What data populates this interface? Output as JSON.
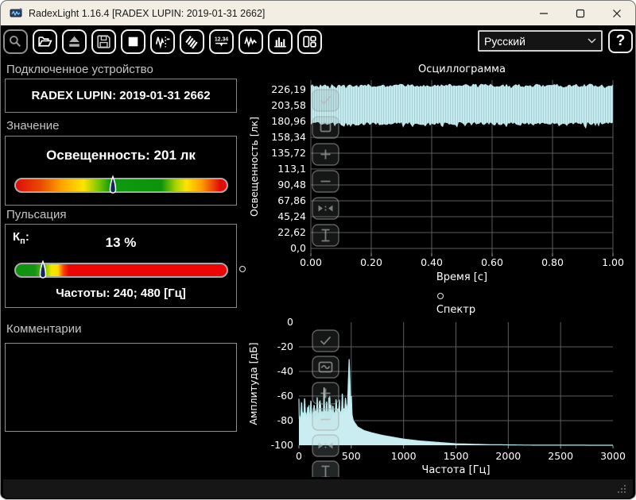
{
  "window": {
    "title": "RadexLight 1.16.4 [RADEX LUPIN: 2019-01-31 2662]"
  },
  "toolbar": {
    "buttons": [
      {
        "name": "search-device",
        "icon": "magnifier-icon",
        "enabled": false
      },
      {
        "name": "open-file",
        "icon": "open-folder-icon",
        "enabled": true
      },
      {
        "name": "eject-device",
        "icon": "eject-icon",
        "enabled": false
      },
      {
        "name": "save-file",
        "icon": "floppy-disk-icon",
        "enabled": false
      },
      {
        "name": "stop-measurement",
        "icon": "stop-square-icon",
        "enabled": true
      },
      {
        "name": "measurement-mode",
        "icon": "waveform-marker-icon",
        "enabled": true
      },
      {
        "name": "pulsation-mode",
        "icon": "hatch-lines-icon",
        "enabled": true
      },
      {
        "name": "value-display-view",
        "icon": "digital-readout-icon",
        "label_in_icon": "12.34",
        "enabled": true
      },
      {
        "name": "oscillogram-view",
        "icon": "oscillogram-icon",
        "enabled": true
      },
      {
        "name": "spectrum-view",
        "icon": "bar-chart-icon",
        "enabled": true
      },
      {
        "name": "layout-view",
        "icon": "layout-panels-icon",
        "enabled": true
      }
    ],
    "language_select": {
      "value": "Русский"
    },
    "help_label": "?"
  },
  "left_panel": {
    "device": {
      "header": "Подключенное устройство",
      "name": "RADEX LUPIN: 2019-01-31 2662"
    },
    "value": {
      "header": "Значение",
      "reading": "Освещенность: 201 лк",
      "marker_fraction": 0.46
    },
    "pulsation": {
      "header": "Пульсация",
      "coef_main": "К",
      "coef_sub": "п",
      "coef_colon": ":",
      "value": "13 %",
      "marker_fraction": 0.13,
      "frequencies": "Частоты: 240; 480 [Гц]"
    },
    "comments": {
      "header": "Комментарии",
      "text": ""
    }
  },
  "colors": {
    "accent_cyan": "#c9edf1",
    "cyan_edge": "#b9ecf0",
    "grid": "#5d5d5d",
    "titlebar_bg": "#f2eee3",
    "good_green": "#0c940c",
    "warn_yellow": "#ffe400",
    "bad_red": "#e00b0b"
  },
  "chart_data": [
    {
      "type": "area",
      "title": "Осциллограмма",
      "xlabel": "Время [с]",
      "ylabel": "Освещенность [лк]",
      "xlim": [
        0,
        1
      ],
      "xticks": [
        "0.00",
        "0.20",
        "0.40",
        "0.60",
        "0.80",
        "1.00"
      ],
      "ylim": [
        0,
        239.8
      ],
      "yticks": [
        226.19,
        203.58,
        180.96,
        158.34,
        135.72,
        113.1,
        90.48,
        67.86,
        45.24,
        22.62,
        0.0
      ],
      "ytick_labels": [
        "226,19",
        "203,58",
        "180,96",
        "158,34",
        "135,72",
        "113,1",
        "90,48",
        "67,86",
        "45,24",
        "22,62",
        "0,0"
      ],
      "grid": true,
      "legend": false,
      "series": [
        {
          "name": "освещенность",
          "kind": "dense-ripple-band",
          "top_lx": 233,
          "bottom_lx": 180,
          "mean_lx": 201,
          "ripple_freqs_hz": [
            240,
            480
          ]
        }
      ]
    },
    {
      "type": "area",
      "title": "Спектр",
      "xlabel": "Частота [Гц]",
      "ylabel": "Амплитуда [дБ]",
      "xlim": [
        0,
        3000
      ],
      "xticks": [
        0,
        500,
        1000,
        1500,
        2000,
        2500,
        3000
      ],
      "ylim": [
        -100,
        0
      ],
      "yticks": [
        0,
        -20,
        -40,
        -60,
        -80,
        -100
      ],
      "grid": true,
      "legend": false,
      "floor_points": [
        [
          0,
          -76
        ],
        [
          60,
          -74
        ],
        [
          140,
          -75
        ],
        [
          220,
          -73
        ],
        [
          300,
          -75
        ],
        [
          380,
          -72
        ],
        [
          460,
          -70
        ],
        [
          500,
          -72
        ],
        [
          520,
          -80
        ],
        [
          560,
          -85
        ],
        [
          620,
          -88
        ],
        [
          700,
          -90
        ],
        [
          800,
          -92
        ],
        [
          900,
          -93.5
        ],
        [
          1000,
          -95
        ],
        [
          1150,
          -96.5
        ],
        [
          1300,
          -97.5
        ],
        [
          1500,
          -98.8
        ],
        [
          1800,
          -99.5
        ],
        [
          2200,
          -99.9
        ],
        [
          3000,
          -100
        ]
      ],
      "spikes": [
        [
          25,
          -64
        ],
        [
          55,
          -60
        ],
        [
          85,
          -68
        ],
        [
          115,
          -62
        ],
        [
          145,
          -66
        ],
        [
          175,
          -59
        ],
        [
          205,
          -64
        ],
        [
          240,
          -53
        ],
        [
          265,
          -63
        ],
        [
          295,
          -58
        ],
        [
          325,
          -67
        ],
        [
          355,
          -61
        ],
        [
          385,
          -65
        ],
        [
          415,
          -56
        ],
        [
          445,
          -60
        ],
        [
          480,
          -30
        ],
        [
          500,
          -58
        ]
      ]
    }
  ]
}
